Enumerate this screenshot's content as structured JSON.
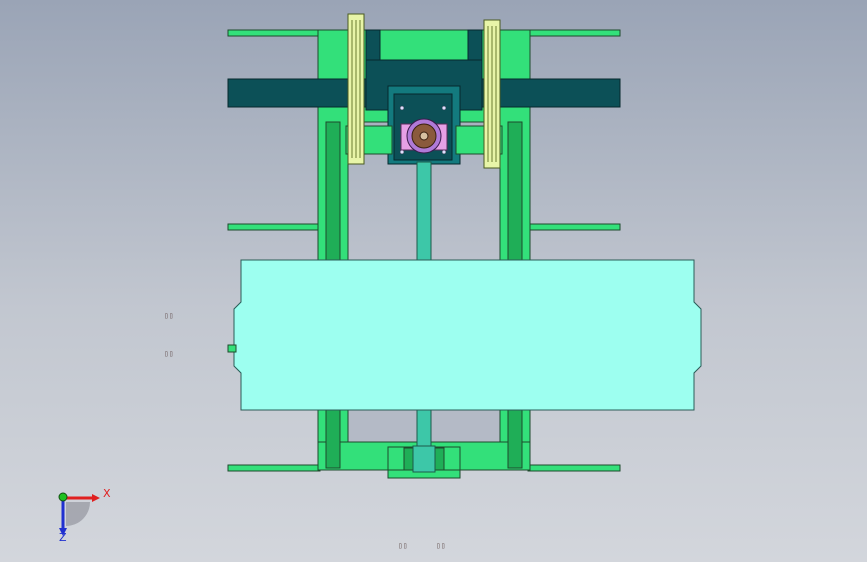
{
  "colors": {
    "frame_green": "#33e07a",
    "frame_dark_green": "#1fae57",
    "outline": "#1d4a2c",
    "dark_teal": "#0c5057",
    "mid_teal": "#137a7e",
    "table_cyan": "#9dfff0",
    "shaft": "#3dc7a8",
    "wheel_yellow": "#e8f5a8",
    "hub_purple": "#b07ad8",
    "hub_pink": "#e6a0e6",
    "hub_brown": "#8a5a3c",
    "axis_x": "#e02020",
    "axis_y": "#20c020",
    "axis_z": "#2030d0"
  },
  "axes": {
    "x_label": "X",
    "z_label": "Z"
  },
  "markers": [
    "▯▯",
    "▯▯",
    "▯▯",
    "▯▯"
  ]
}
